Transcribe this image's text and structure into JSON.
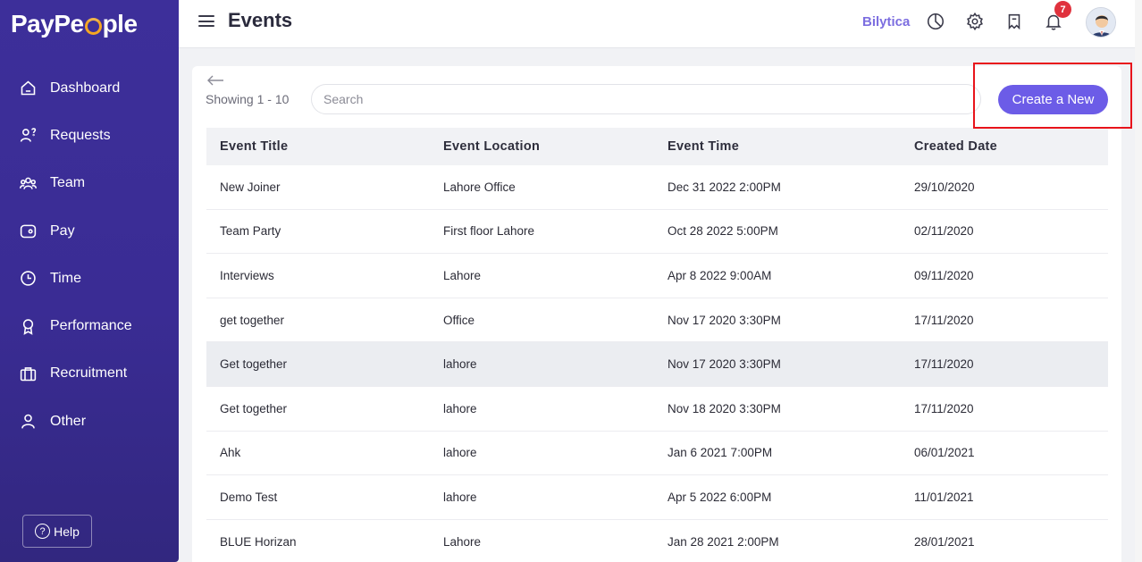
{
  "brand": {
    "logo_pre": "PayPe",
    "logo_post": "ple"
  },
  "sidebar": {
    "items": [
      {
        "label": "Dashboard",
        "icon": "home-icon"
      },
      {
        "label": "Requests",
        "icon": "requests-icon"
      },
      {
        "label": "Team",
        "icon": "team-icon"
      },
      {
        "label": "Pay",
        "icon": "wallet-icon"
      },
      {
        "label": "Time",
        "icon": "clock-icon"
      },
      {
        "label": "Performance",
        "icon": "award-icon"
      },
      {
        "label": "Recruitment",
        "icon": "briefcase-icon"
      },
      {
        "label": "Other",
        "icon": "user-icon"
      }
    ],
    "help_label": "Help"
  },
  "header": {
    "title": "Events",
    "company": "Bilytica",
    "notification_count": "7"
  },
  "toolbar": {
    "showing": "Showing 1 - 10",
    "search_placeholder": "Search",
    "create_label": "Create a New"
  },
  "table": {
    "columns": [
      "Event Title",
      "Event Location",
      "Event Time",
      "Created Date"
    ],
    "rows": [
      [
        "New Joiner",
        "Lahore Office",
        "Dec 31 2022 2:00PM",
        "29/10/2020"
      ],
      [
        "Team Party",
        "First floor Lahore",
        "Oct 28 2022 5:00PM",
        "02/11/2020"
      ],
      [
        "Interviews",
        "Lahore",
        "Apr 8 2022 9:00AM",
        "09/11/2020"
      ],
      [
        "get together",
        "Office",
        "Nov 17 2020 3:30PM",
        "17/11/2020"
      ],
      [
        "Get together",
        "lahore",
        "Nov 17 2020 3:30PM",
        "17/11/2020"
      ],
      [
        "Get together",
        "lahore",
        "Nov 18 2020 3:30PM",
        "17/11/2020"
      ],
      [
        "Ahk",
        "lahore",
        "Jan 6 2021 7:00PM",
        "06/01/2021"
      ],
      [
        "Demo Test",
        "lahore",
        "Apr 5 2022 6:00PM",
        "11/01/2021"
      ],
      [
        "BLUE Horizan",
        "Lahore",
        "Jan 28 2021 2:00PM",
        "28/01/2021"
      ]
    ]
  },
  "colors": {
    "sidebar_bg": "#3d2f9a",
    "accent": "#6c5ce7",
    "company_text": "#7c6ee0",
    "badge": "#e0323d",
    "logo_ring": "#f5a623",
    "highlight_box": "#e8141b"
  }
}
